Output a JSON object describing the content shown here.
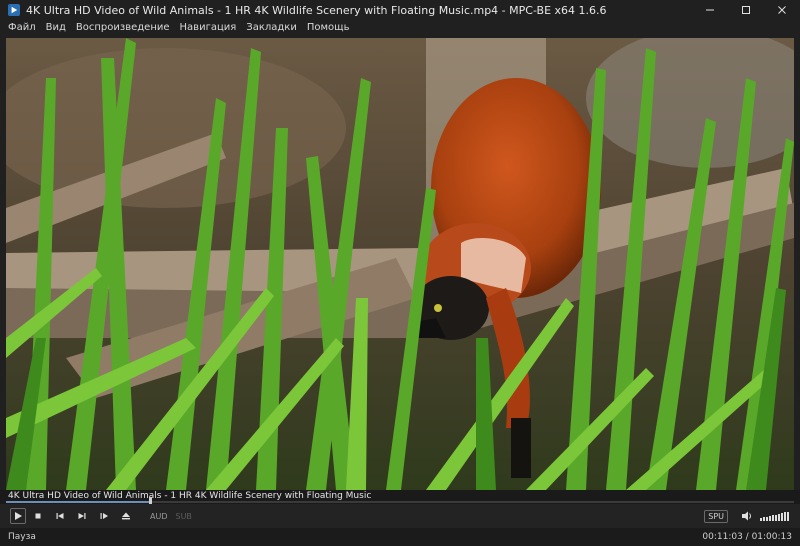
{
  "window": {
    "title": "4K Ultra HD Video of Wild Animals - 1 HR 4K Wildlife Scenery with Floating Music.mp4 - MPC-BE x64 1.6.6"
  },
  "menu": {
    "items": [
      "Файл",
      "Вид",
      "Воспроизведение",
      "Навигация",
      "Закладки",
      "Помощь"
    ]
  },
  "video": {
    "content": "red-ruffed-lemur-in-grass"
  },
  "seek": {
    "caption": "4K Ultra HD Video of Wild Animals - 1 HR 4K Wildlife Scenery with Floating Music",
    "position_fraction": 0.183
  },
  "controls": {
    "play_icon": "play-icon",
    "stop_icon": "stop-icon",
    "prev_icon": "skip-back-icon",
    "next_icon": "skip-forward-icon",
    "frame_icon": "frame-step-icon",
    "eject_icon": "eject-icon",
    "audio_tag": "AUD",
    "sub_tag": "SUB",
    "spu_label": "SPU",
    "volume_level": 1.0
  },
  "status": {
    "state": "Пауза",
    "time": "00:11:03 / 01:00:13"
  },
  "colors": {
    "accent": "#6b8fb8",
    "window_bg": "#202020"
  }
}
